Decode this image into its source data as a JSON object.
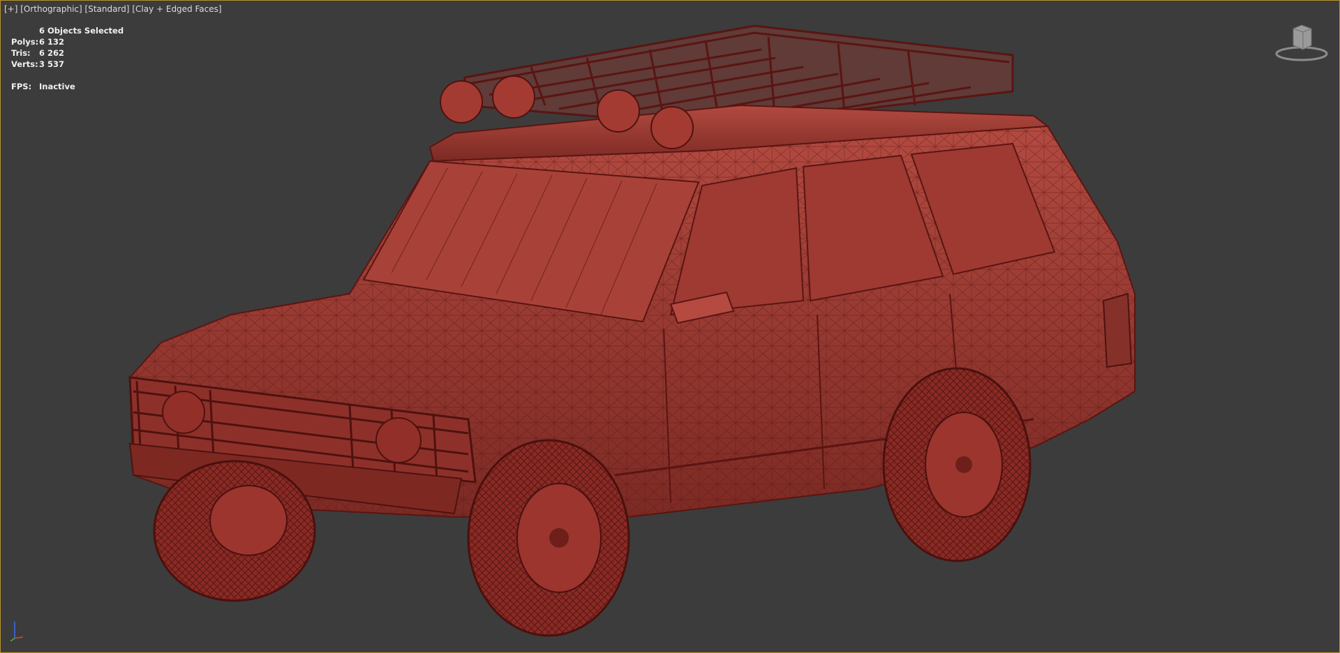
{
  "viewport": {
    "label_parts": [
      "[+]",
      "[Orthographic]",
      "[Standard]",
      "[Clay + Edged Faces]"
    ]
  },
  "stats": {
    "selected": "6 Objects Selected",
    "polys_label": "Polys:",
    "polys": "6 132",
    "tris_label": "Tris:",
    "tris": "6 262",
    "verts_label": "Verts:",
    "verts": "3 537",
    "fps_label": "FPS:",
    "fps": "Inactive"
  },
  "icons": {
    "viewcube": "viewcube-icon",
    "axis": "axis-tripod-icon"
  },
  "colors": {
    "viewport_bg": "#3c3c3c",
    "active_border": "#b8912c",
    "clay": "#a23a32",
    "edge": "#5a1512"
  }
}
